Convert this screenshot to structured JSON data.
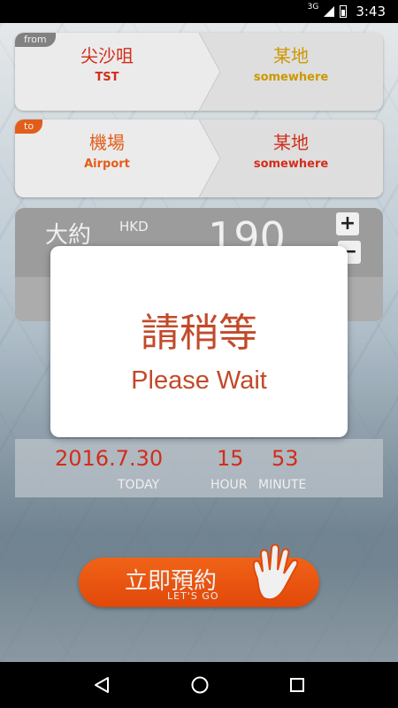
{
  "status_bar": {
    "network": "3G",
    "time": "3:43"
  },
  "from_card": {
    "tag": "from",
    "origin_zh": "尖沙咀",
    "origin_en": "TST",
    "dest_zh": "某地",
    "dest_en": "somewhere"
  },
  "to_card": {
    "tag": "to",
    "origin_zh": "機場",
    "origin_en": "Airport",
    "dest_zh": "某地",
    "dest_en": "somewhere"
  },
  "fare": {
    "approx_label": "大約",
    "currency": "HKD",
    "amount": "190",
    "plus_label": "+",
    "minus_label": "−"
  },
  "datetime": {
    "date": "2016.7.30",
    "date_label": "TODAY",
    "hour": "15",
    "hour_label": "HOUR",
    "minute": "53",
    "minute_label": "MINUTE"
  },
  "dialog": {
    "title_zh": "請稍等",
    "title_en": "Please Wait"
  },
  "go_button": {
    "label_zh": "立即預約",
    "label_en": "LET'S GO"
  },
  "colors": {
    "accent_orange": "#f14d0a",
    "tag_from": "#8a8a8a",
    "tag_to": "#f2631c",
    "red_text": "#e0301c",
    "gold_text": "#d9a200",
    "orange_text": "#f2631c"
  }
}
